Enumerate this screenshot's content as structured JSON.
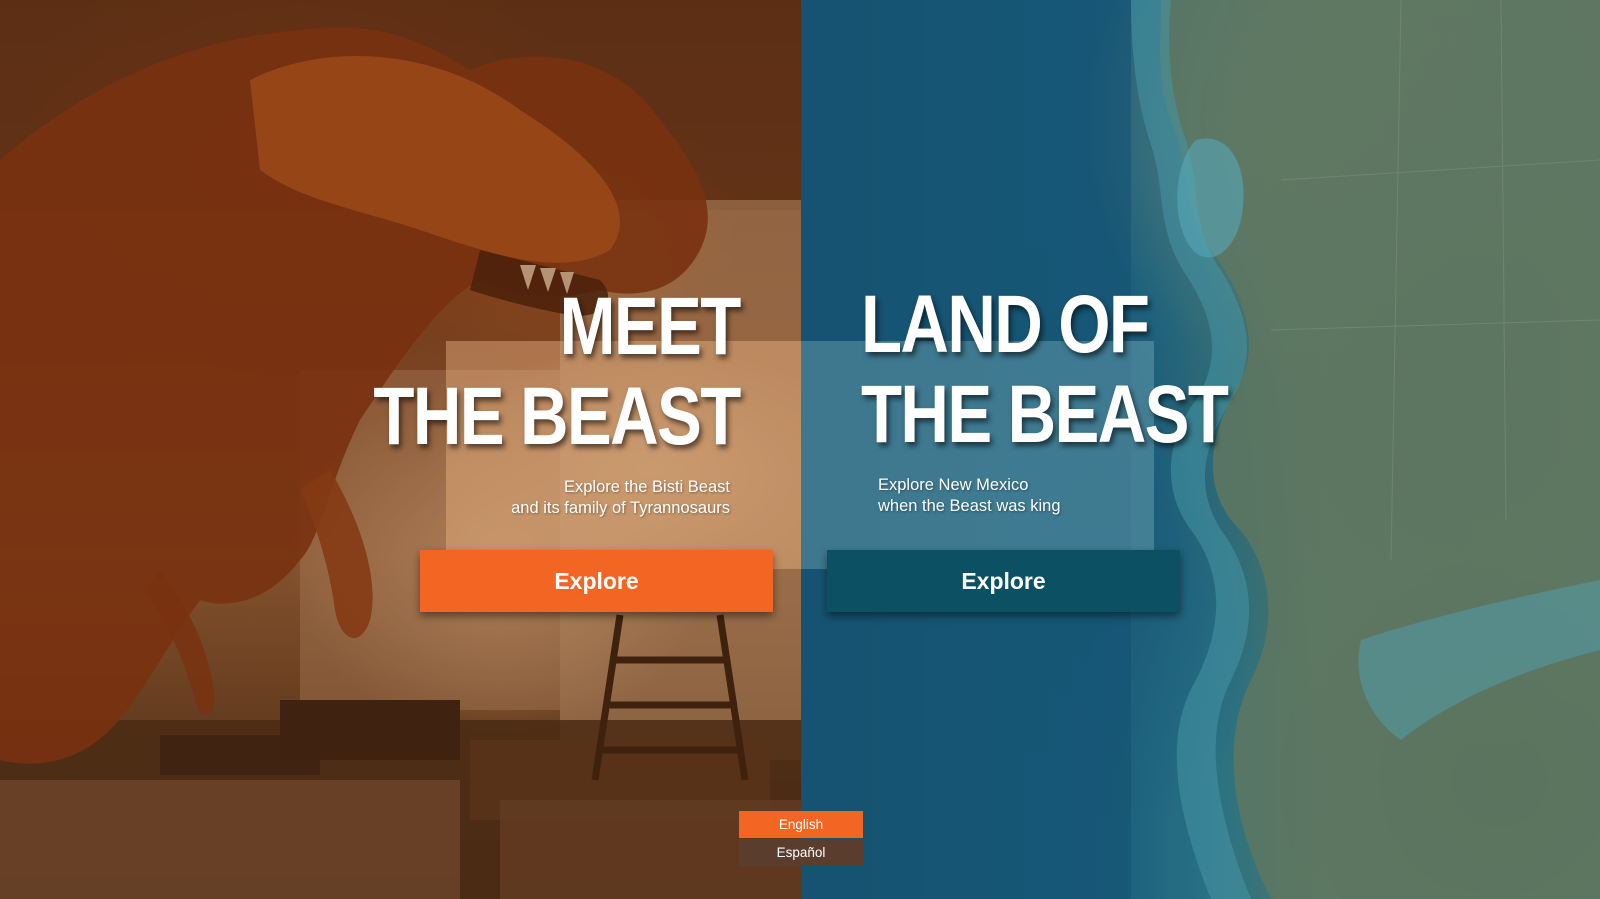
{
  "left_panel": {
    "heading_line1": "MEET",
    "heading_line2": "THE BEAST",
    "subtitle_line1": "Explore the Bisti Beast",
    "subtitle_line2": "and its family of Tyrannosaurs",
    "button_label": "Explore",
    "button_color": "#f26522",
    "image": "tyrannosaur-skeleton-photo"
  },
  "right_panel": {
    "heading_line1": "LAND OF",
    "heading_line2": "THE BEAST",
    "subtitle_line1": "Explore New Mexico",
    "subtitle_line2": "when the Beast was king",
    "button_label": "Explore",
    "button_color": "#0b5063",
    "image": "cretaceous-north-america-map"
  },
  "language": {
    "options": [
      "English",
      "Español"
    ],
    "selected": "English",
    "active_color": "#f26522",
    "inactive_color": "#5a3d2c"
  }
}
